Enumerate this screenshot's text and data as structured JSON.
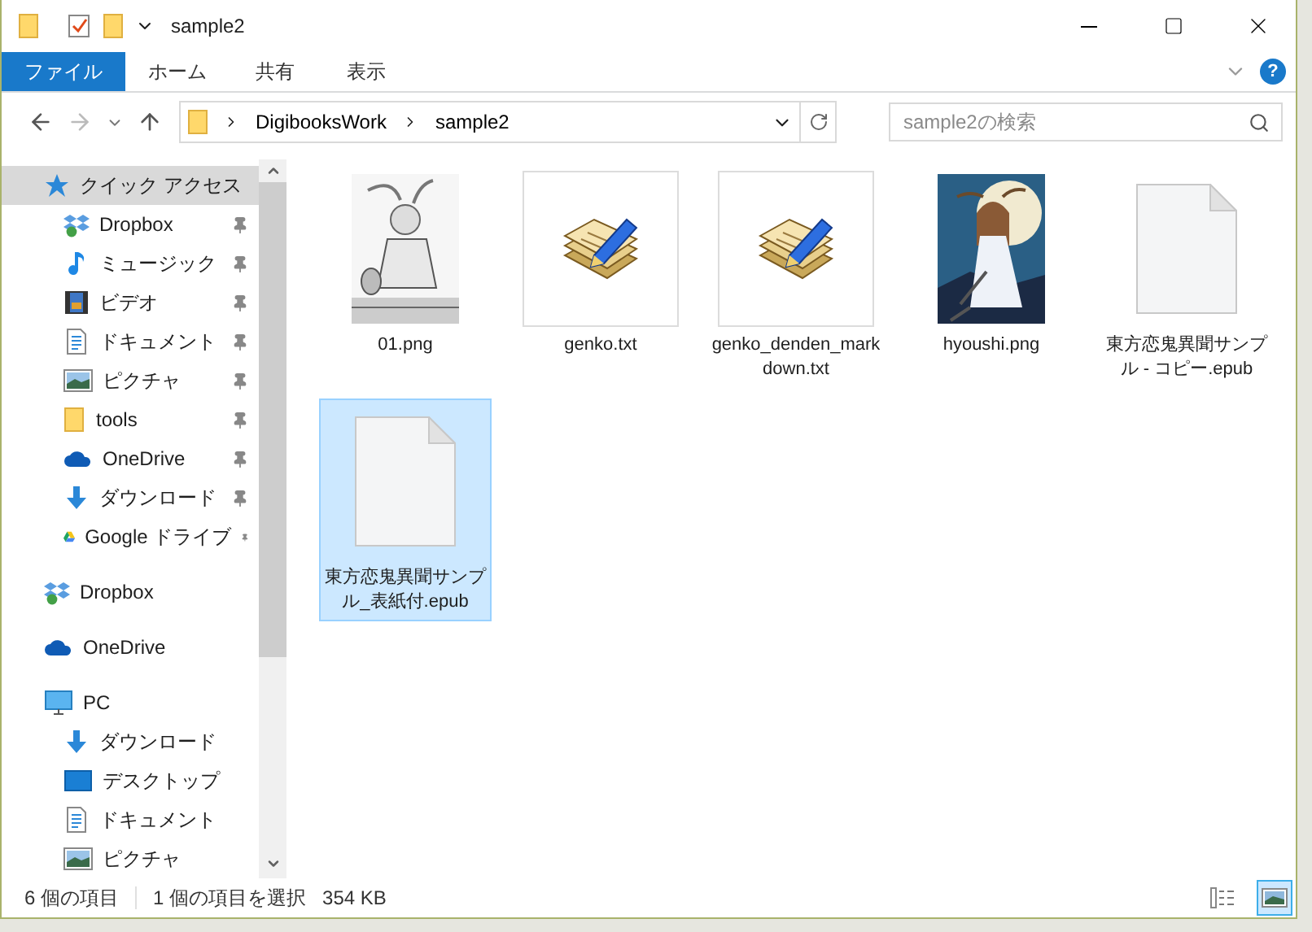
{
  "title_bar": {
    "title": "sample2"
  },
  "ribbon": {
    "tabs": [
      {
        "label": "ファイル",
        "selected": true
      },
      {
        "label": "ホーム",
        "selected": false
      },
      {
        "label": "共有",
        "selected": false
      },
      {
        "label": "表示",
        "selected": false
      }
    ],
    "help": "?"
  },
  "address_bar": {
    "path": [
      "DigibooksWork",
      "sample2"
    ],
    "search": {
      "placeholder": "sample2の検索"
    }
  },
  "sidebar": {
    "items": [
      {
        "label": "クイック アクセス",
        "kind": "star",
        "selected": true,
        "children": [
          {
            "label": "Dropbox",
            "kind": "dropbox",
            "pinned": true
          },
          {
            "label": "ミュージック",
            "kind": "music",
            "pinned": true
          },
          {
            "label": "ビデオ",
            "kind": "video",
            "pinned": true
          },
          {
            "label": "ドキュメント",
            "kind": "document",
            "pinned": true
          },
          {
            "label": "ピクチャ",
            "kind": "picture",
            "pinned": true
          },
          {
            "label": "tools",
            "kind": "folder",
            "pinned": true
          },
          {
            "label": "OneDrive",
            "kind": "cloud",
            "pinned": true
          },
          {
            "label": "ダウンロード",
            "kind": "download",
            "pinned": true
          },
          {
            "label": "Google ドライブ",
            "kind": "drive",
            "pinned": true
          }
        ]
      },
      {
        "label": "Dropbox",
        "kind": "dropbox",
        "selected": false
      },
      {
        "label": "OneDrive",
        "kind": "cloud",
        "selected": false
      },
      {
        "label": "PC",
        "kind": "pc",
        "selected": false,
        "children": [
          {
            "label": "ダウンロード",
            "kind": "download",
            "pinned": false
          },
          {
            "label": "デスクトップ",
            "kind": "desktop",
            "pinned": false
          },
          {
            "label": "ドキュメント",
            "kind": "document",
            "pinned": false
          },
          {
            "label": "ピクチャ",
            "kind": "picture",
            "pinned": false
          }
        ]
      }
    ]
  },
  "files": [
    {
      "name": "01.png",
      "kind": "picture",
      "selected": false
    },
    {
      "name": "genko.txt",
      "kind": "text",
      "selected": false
    },
    {
      "name": "genko_denden_markdown.txt",
      "kind": "text",
      "selected": false
    },
    {
      "name": "hyoushi.png",
      "kind": "picture",
      "selected": false
    },
    {
      "name": "東方恋鬼異聞サンプル - コピー.epub",
      "kind": "document",
      "selected": false
    },
    {
      "name": "東方恋鬼異聞サンプル_表紙付.epub",
      "kind": "document",
      "selected": true
    }
  ],
  "status_bar": {
    "item_count": "6 個の項目",
    "selection": "1 個の項目を選択",
    "size": "354 KB",
    "views": [
      {
        "kind": "details",
        "selected": false
      },
      {
        "kind": "large_icons",
        "selected": true
      }
    ]
  }
}
